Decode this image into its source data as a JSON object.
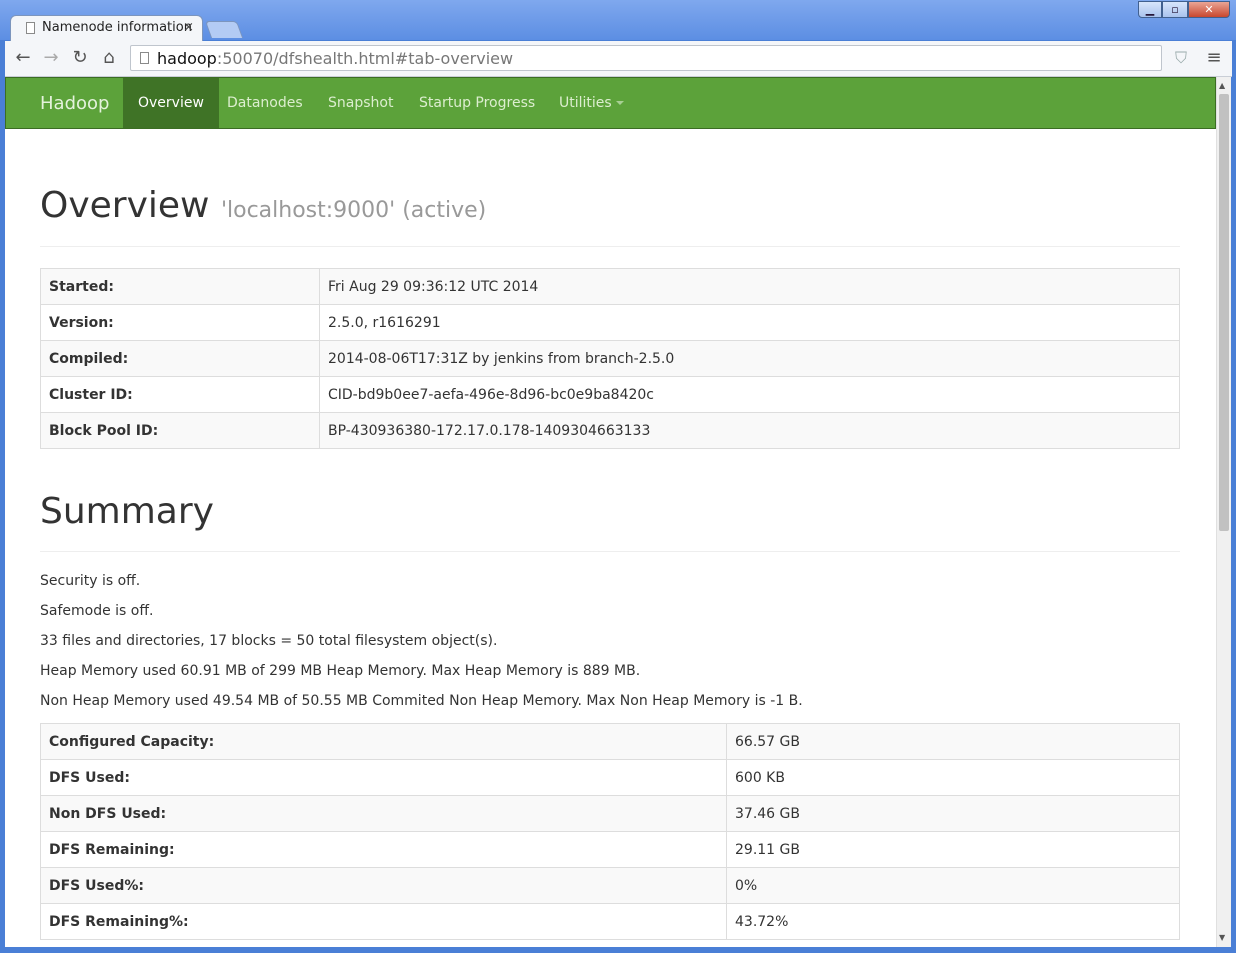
{
  "browser": {
    "tab_title": "Namenode information",
    "tab_close": "×",
    "url_host": "hadoop",
    "url_rest": ":50070/dfshealth.html#tab-overview"
  },
  "navbar": {
    "brand": "Hadoop",
    "items": [
      "Overview",
      "Datanodes",
      "Snapshot",
      "Startup Progress",
      "Utilities"
    ],
    "active_color": "#3f7326",
    "bar_color": "#5ca23a"
  },
  "overview": {
    "title": "Overview",
    "subtitle": "'localhost:9000' (active)",
    "rows": [
      {
        "key": "Started:",
        "value": "Fri Aug 29 09:36:12 UTC 2014"
      },
      {
        "key": "Version:",
        "value": "2.5.0, r1616291"
      },
      {
        "key": "Compiled:",
        "value": "2014-08-06T17:31Z by jenkins from branch-2.5.0"
      },
      {
        "key": "Cluster ID:",
        "value": "CID-bd9b0ee7-aefa-496e-8d96-bc0e9ba8420c"
      },
      {
        "key": "Block Pool ID:",
        "value": "BP-430936380-172.17.0.178-1409304663133"
      }
    ]
  },
  "summary": {
    "title": "Summary",
    "lines": [
      "Security is off.",
      "Safemode is off.",
      "33 files and directories, 17 blocks = 50 total filesystem object(s).",
      "Heap Memory used 60.91 MB of 299 MB Heap Memory. Max Heap Memory is 889 MB.",
      "Non Heap Memory used 49.54 MB of 50.55 MB Commited Non Heap Memory. Max Non Heap Memory is -1 B."
    ],
    "rows": [
      {
        "key": "Configured Capacity:",
        "value": "66.57 GB"
      },
      {
        "key": "DFS Used:",
        "value": "600 KB"
      },
      {
        "key": "Non DFS Used:",
        "value": "37.46 GB"
      },
      {
        "key": "DFS Remaining:",
        "value": "29.11 GB"
      },
      {
        "key": "DFS Used%:",
        "value": "0%"
      },
      {
        "key": "DFS Remaining%:",
        "value": "43.72%"
      }
    ]
  }
}
